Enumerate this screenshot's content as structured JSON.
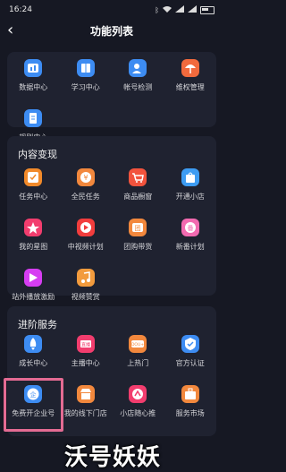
{
  "status_bar": {
    "time": "16:24",
    "icons": [
      "bluetooth-icon",
      "wifi-icon",
      "signal-icon",
      "signal-icon",
      "battery-icon"
    ]
  },
  "nav": {
    "back_icon": "chevron-left-icon",
    "title": "功能列表"
  },
  "section1": {
    "items": [
      {
        "label": "数据中心",
        "icon": "chart-icon",
        "color": "#3d8cf2"
      },
      {
        "label": "学习中心",
        "icon": "book-icon",
        "color": "#3d8cf2"
      },
      {
        "label": "帐号检测",
        "icon": "user-check-icon",
        "color": "#3d8cf2"
      },
      {
        "label": "维权管理",
        "icon": "umbrella-icon",
        "color": "#f26a3d"
      },
      {
        "label": "规则中心",
        "icon": "document-icon",
        "color": "#3d8cf2"
      }
    ]
  },
  "section2": {
    "title": "内容变现",
    "items": [
      {
        "label": "任务中心",
        "icon": "check-task-icon",
        "color": "#f28a2a"
      },
      {
        "label": "全民任务",
        "icon": "yen-icon",
        "color": "#f2883d"
      },
      {
        "label": "商品橱窗",
        "icon": "cart-icon",
        "color": "#f2533d"
      },
      {
        "label": "开通小店",
        "icon": "shop-icon",
        "color": "#3d9cf2"
      },
      {
        "label": "我的星图",
        "icon": "star-icon",
        "color": "#f23d6e"
      },
      {
        "label": "中视频计划",
        "icon": "play-icon",
        "color": "#f23d3d"
      },
      {
        "label": "团购带货",
        "icon": "group-icon",
        "color": "#f2883d"
      },
      {
        "label": "新番计划",
        "icon": "fan-icon",
        "color": "#f26ab0"
      },
      {
        "label": "站外播放激励",
        "icon": "video-reward-icon",
        "color": "#d63df2"
      },
      {
        "label": "视频赞赏",
        "icon": "music-gift-icon",
        "color": "#f29b3d"
      }
    ]
  },
  "section3": {
    "title": "进阶服务",
    "items": [
      {
        "label": "成长中心",
        "icon": "rocket-icon",
        "color": "#3d8cf2"
      },
      {
        "label": "主播中心",
        "icon": "live-icon",
        "color": "#f23d6e"
      },
      {
        "label": "上热门",
        "icon": "dou-plus-icon",
        "color": "#f2883d"
      },
      {
        "label": "官方认证",
        "icon": "verified-icon",
        "color": "#3d8cf2"
      },
      {
        "label": "免费开企业号",
        "icon": "enterprise-icon",
        "color": "#3d8cf2"
      },
      {
        "label": "我的线下门店",
        "icon": "store-icon",
        "color": "#f2883d"
      },
      {
        "label": "小店随心推",
        "icon": "promote-icon",
        "color": "#f23d6e"
      },
      {
        "label": "服务市场",
        "icon": "briefcase-icon",
        "color": "#f2883d"
      }
    ]
  },
  "watermark": {
    "text": "沃号妖妖"
  }
}
